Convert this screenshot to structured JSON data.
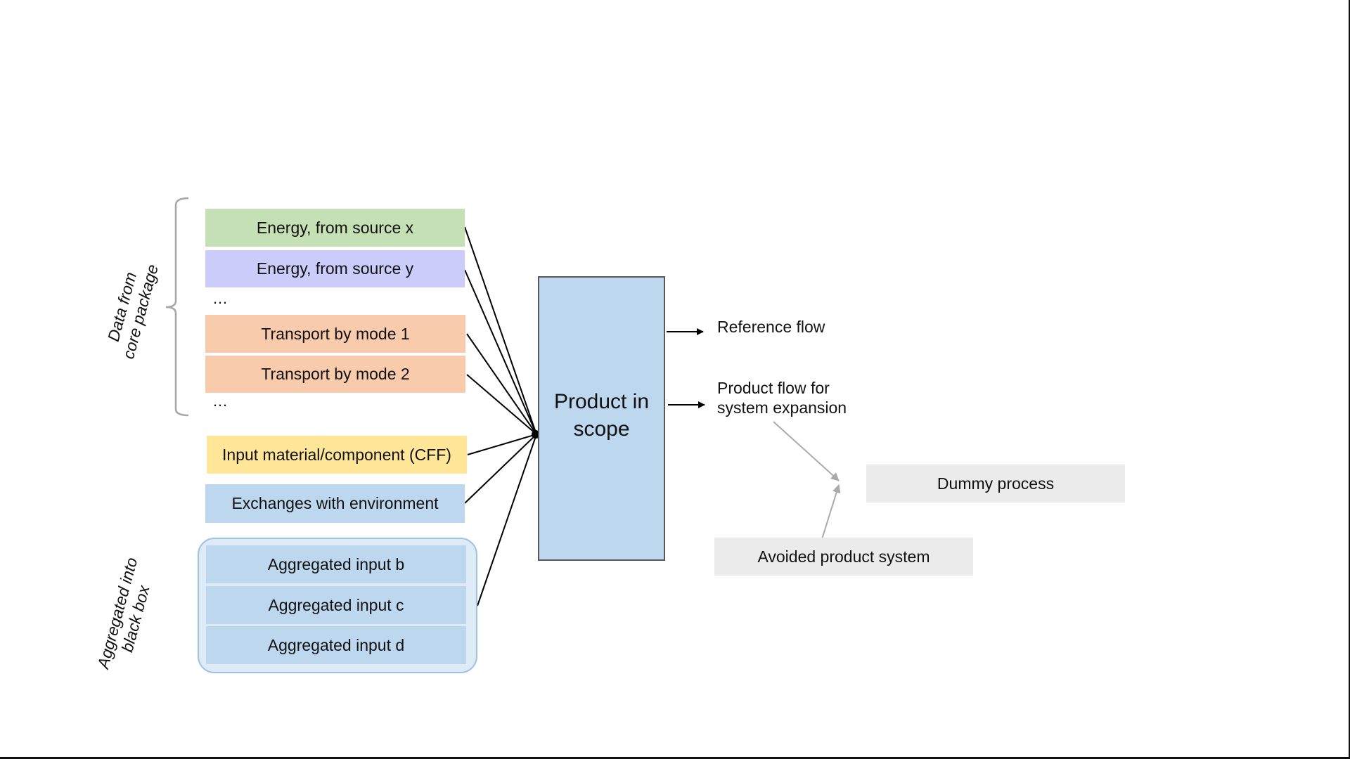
{
  "diagram": {
    "core_group_label": [
      "Data from",
      "core package"
    ],
    "aggregated_group_label": [
      "Aggregated into",
      "black box"
    ],
    "inputs": [
      {
        "id": "energy_x",
        "label": "Energy, from source x",
        "color": "#c5e0b4"
      },
      {
        "id": "energy_y",
        "label": "Energy, from source y",
        "color": "#ccccfb"
      },
      {
        "id": "transport_1",
        "label": "Transport by mode 1",
        "color": "#f8cbad"
      },
      {
        "id": "transport_2",
        "label": "Transport by mode 2",
        "color": "#f8cbad"
      },
      {
        "id": "input_material",
        "label": "Input material/component (CFF)",
        "color": "#ffe699"
      },
      {
        "id": "exchanges",
        "label": "Exchanges with environment",
        "color": "#bdd7ee"
      }
    ],
    "ellipsis": "…",
    "aggregated_inputs": [
      {
        "label": "Aggregated input b"
      },
      {
        "label": "Aggregated input c"
      },
      {
        "label": "Aggregated input d"
      }
    ],
    "product": {
      "line1": "Product in",
      "line2": "scope",
      "color": "#bdd7ee"
    },
    "outputs": [
      {
        "label": "Reference flow"
      },
      {
        "label_lines": [
          "Product flow for",
          "system expansion"
        ]
      }
    ],
    "dummy_process": {
      "label": "Dummy process",
      "color": "#ebebeb"
    },
    "avoided_product_system": {
      "label": "Avoided product system",
      "color": "#ebebeb"
    }
  }
}
